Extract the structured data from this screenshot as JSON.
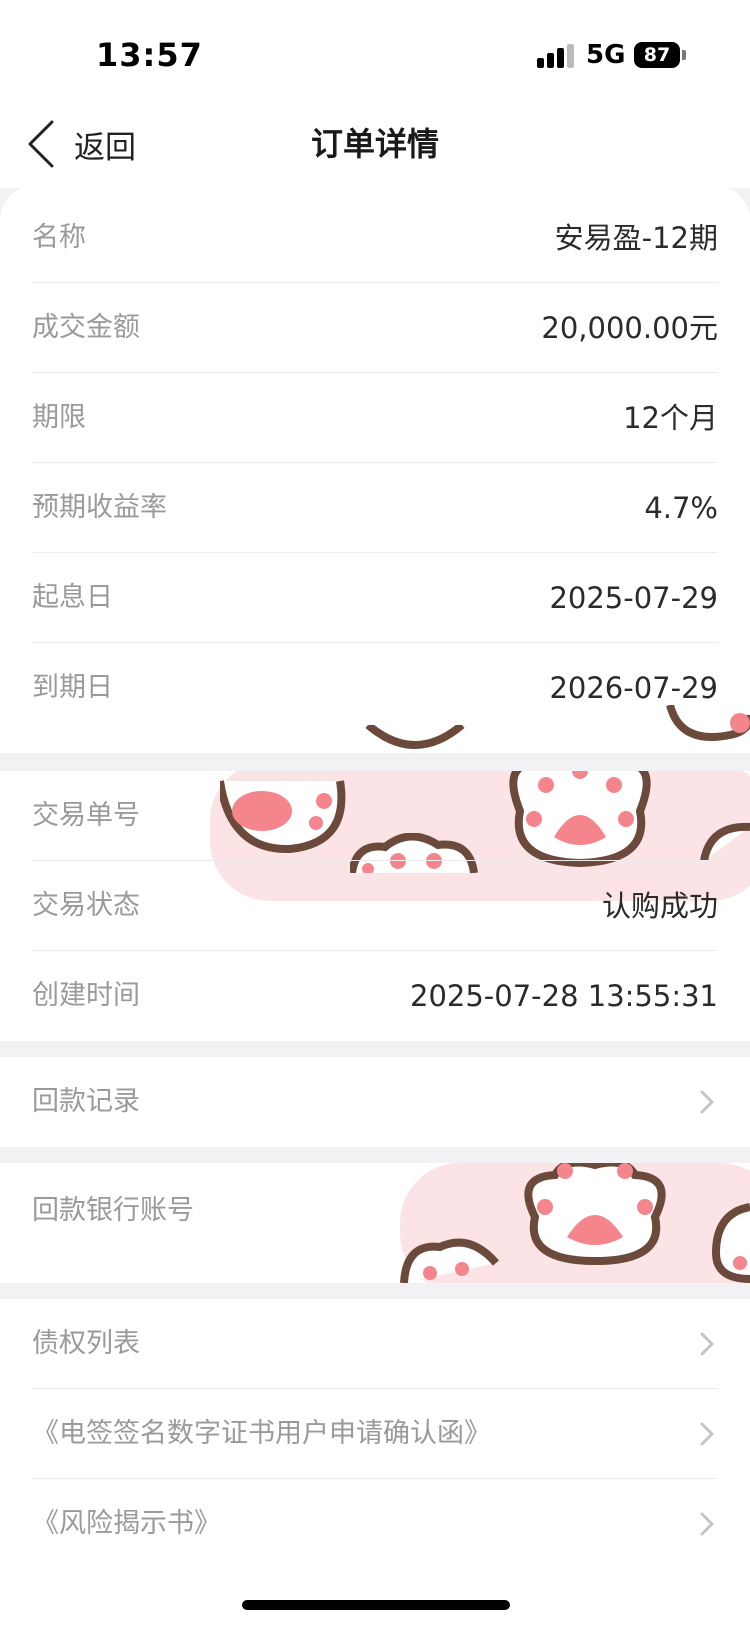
{
  "status_bar": {
    "time": "13:57",
    "network": "5G",
    "battery": "87"
  },
  "nav": {
    "back_label": "返回",
    "title": "订单详情"
  },
  "order_info": [
    {
      "label": "名称",
      "value": "安易盈-12期"
    },
    {
      "label": "成交金额",
      "value": "20,000.00元"
    },
    {
      "label": "期限",
      "value": "12个月"
    },
    {
      "label": "预期收益率",
      "value": "4.7%"
    },
    {
      "label": "起息日",
      "value": "2025-07-29"
    },
    {
      "label": "到期日",
      "value": "2026-07-29"
    }
  ],
  "transaction_info": [
    {
      "label": "交易单号",
      "value": ""
    },
    {
      "label": "交易状态",
      "value": "认购成功"
    },
    {
      "label": "创建时间",
      "value": "2025-07-28 13:55:31"
    }
  ],
  "repayment_record": {
    "label": "回款记录"
  },
  "repayment_bank": {
    "label": "回款银行账号",
    "value": ""
  },
  "documents": [
    {
      "label": "债权列表"
    },
    {
      "label": "《电签签名数字证书用户申请确认函》"
    },
    {
      "label": "《风险揭示书》"
    }
  ],
  "icons": {
    "back": "chevron-left-icon",
    "chevron": "chevron-right-icon",
    "paw": "paw-print-icon"
  },
  "colors": {
    "background": "#f2f2f4",
    "card": "#ffffff",
    "label": "#9a9a9a",
    "value": "#2b2b2b",
    "paw_pink": "#f4858c",
    "paw_outline": "#6b4a3c"
  }
}
